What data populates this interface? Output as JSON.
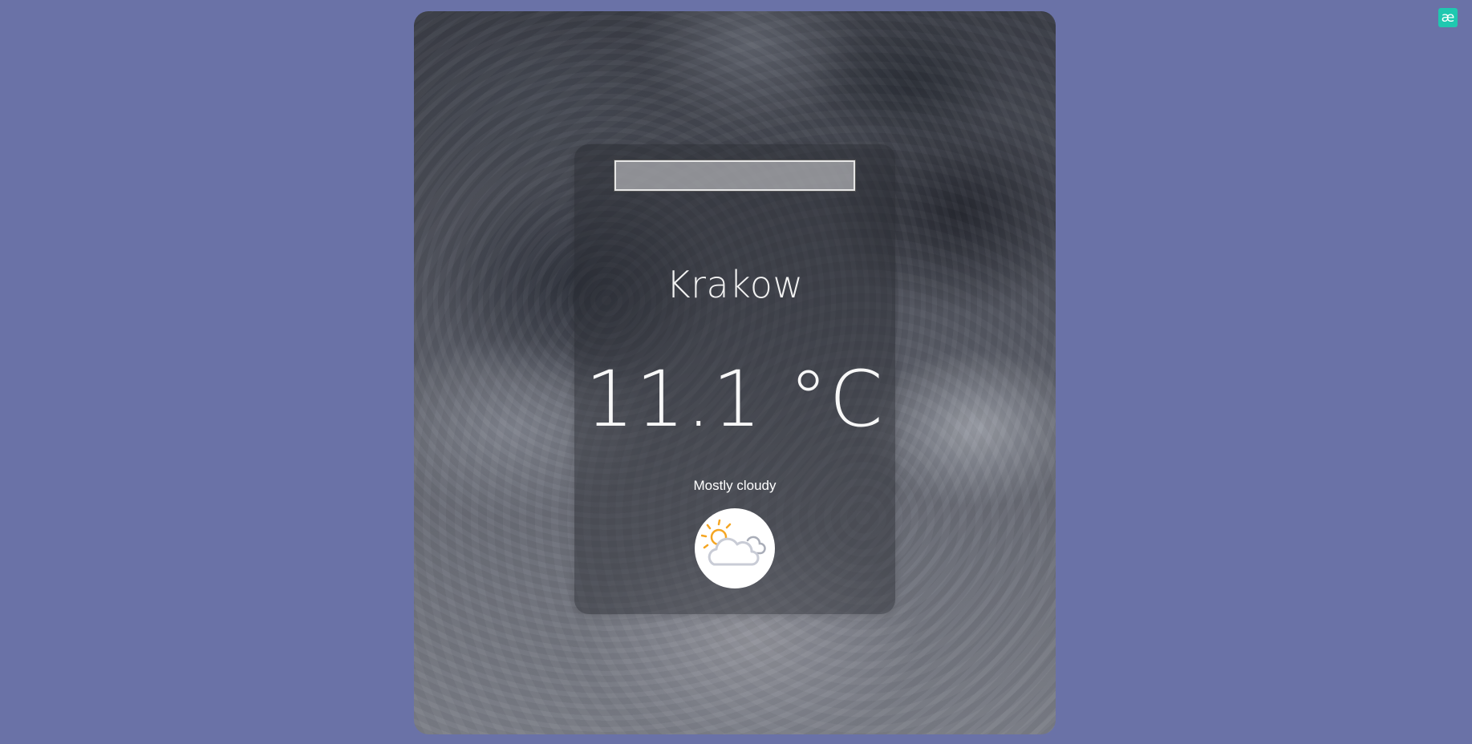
{
  "search": {
    "value": "",
    "placeholder": ""
  },
  "weather": {
    "city": "Krakow",
    "temperature": "11.1 °C",
    "condition": "Mostly cloudy",
    "icon": "partly-cloudy-icon"
  },
  "brand": {
    "logo_text": "æ",
    "color": "#1fc8b0"
  },
  "colors": {
    "page_background": "#6a72a7",
    "sun": "#f5a623",
    "cloud_outline": "#c9ccd6"
  }
}
